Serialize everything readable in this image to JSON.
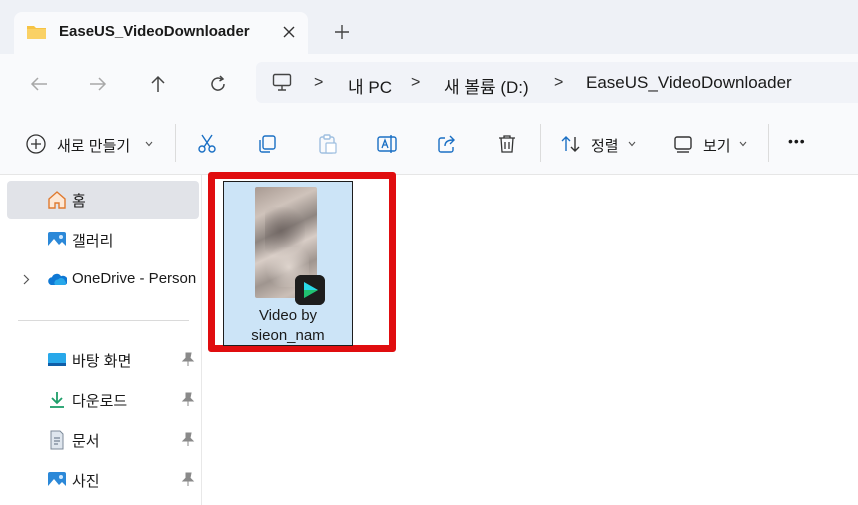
{
  "window": {
    "tab_title": "EaseUS_VideoDownloader"
  },
  "address_bar": {
    "crumbs": [
      "내 PC",
      "새 볼륨 (D:)",
      "EaseUS_VideoDownloader"
    ],
    "separator": ">"
  },
  "toolbar": {
    "new_label": "새로 만들기",
    "sort_label": "정렬",
    "view_label": "보기",
    "more_label": "•••"
  },
  "sidebar": {
    "items": [
      {
        "label": "홈",
        "icon": "home-icon",
        "selected": true
      },
      {
        "label": "갤러리",
        "icon": "gallery-icon"
      },
      {
        "label": "OneDrive - Person",
        "icon": "onedrive-icon",
        "expandable": true
      },
      {
        "label": "바탕 화면",
        "icon": "desktop-icon",
        "pinned": true
      },
      {
        "label": "다운로드",
        "icon": "download-icon",
        "pinned": true
      },
      {
        "label": "문서",
        "icon": "document-icon",
        "pinned": true
      },
      {
        "label": "사진",
        "icon": "pictures-icon",
        "pinned": true
      }
    ]
  },
  "files": [
    {
      "name_line1": "Video by",
      "name_line2": "sieon_nam",
      "selected": true,
      "highlighted": true
    }
  ],
  "colors": {
    "highlight_border": "#e00d0f",
    "selection_fill": "#cce4f7",
    "accent_blue": "#1a6fc4",
    "folder_yellow": "#f6c344",
    "badge_cyan": "#2ad9e8"
  }
}
